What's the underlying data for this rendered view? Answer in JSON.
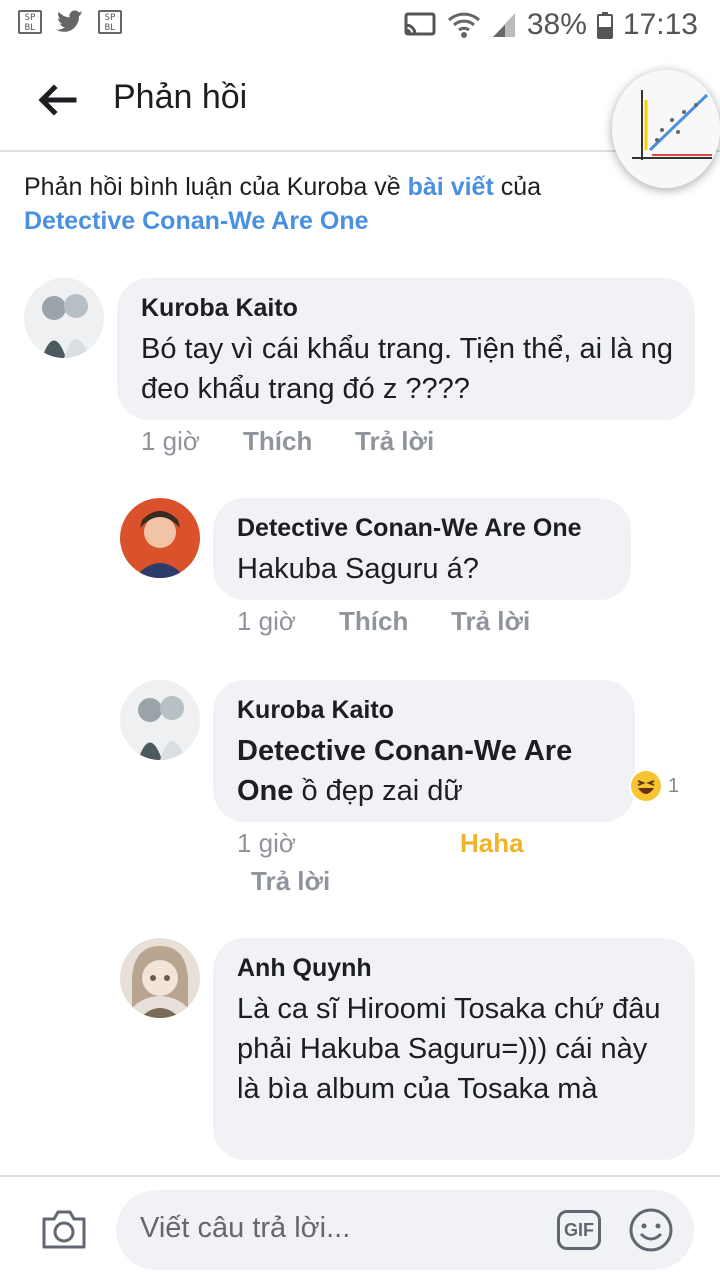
{
  "status": {
    "battery": "38%",
    "time": "17:13",
    "badge1": "SP BL",
    "badge2": "SP BL"
  },
  "header": {
    "title": "Phản hồi"
  },
  "context": {
    "prefix": "Phản hồi bình luận của Kuroba về ",
    "link1": "bài viết",
    "mid": " của",
    "link2": "Detective Conan-We Are One"
  },
  "comments": [
    {
      "author": "Kuroba Kaito",
      "text": "Bó tay vì cái khẩu trang. Tiện thể, ai là ng đeo khẩu trang đó z ????",
      "time": "1 giờ",
      "like": "Thích",
      "reply": "Trả lời"
    },
    {
      "author": "Detective Conan-We Are One",
      "text": "Hakuba Saguru á?",
      "time": "1 giờ",
      "like": "Thích",
      "reply": "Trả lời"
    },
    {
      "author": "Kuroba Kaito",
      "mention": "Detective Conan-We Are One",
      "text": " ồ đẹp zai dữ",
      "time": "1 giờ",
      "like": "Haha",
      "reply": "Trả lời",
      "reaction_count": "1"
    },
    {
      "author": "Anh Quynh",
      "text": "Là ca sĩ Hiroomi Tosaka chứ đâu phải Hakuba Saguru=))) cái này là bìa album của Tosaka mà"
    }
  ],
  "composer": {
    "placeholder": "Viết câu trả lời...",
    "gif": "GIF"
  },
  "colors": {
    "link": "#4a90e2",
    "haha": "#f0b429",
    "bubble": "#f0f2f5"
  }
}
